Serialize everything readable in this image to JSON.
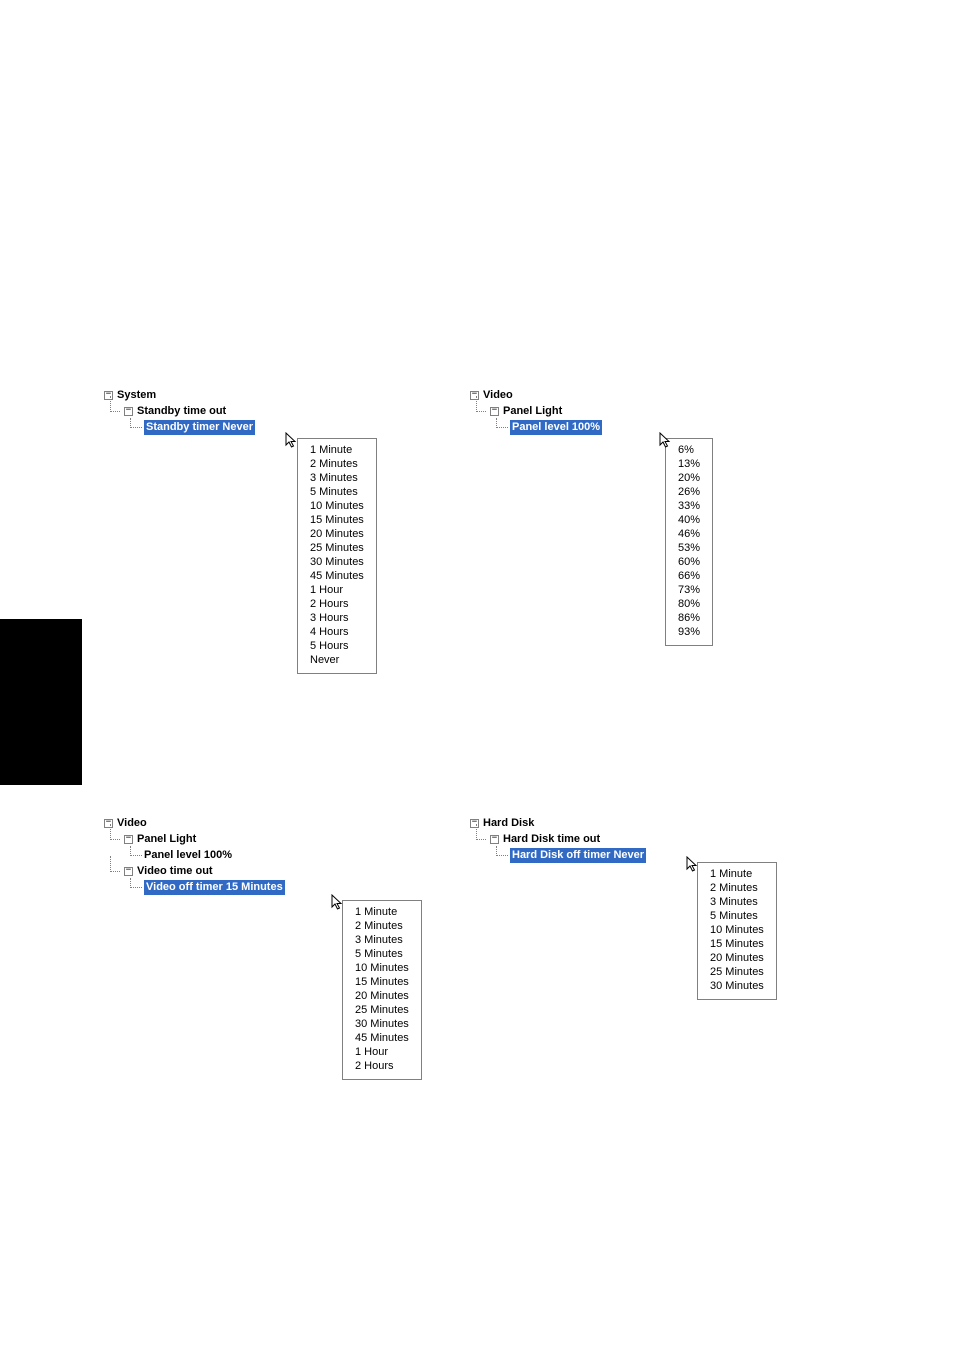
{
  "tree1": {
    "root": "System",
    "level1": "Standby time out",
    "leaf": "Standby timer Never",
    "menu": [
      "1 Minute",
      "2 Minutes",
      "3 Minutes",
      "5 Minutes",
      "10 Minutes",
      "15 Minutes",
      "20 Minutes",
      "25 Minutes",
      "30 Minutes",
      "45 Minutes",
      "1 Hour",
      "2 Hours",
      "3 Hours",
      "4 Hours",
      "5 Hours",
      "Never"
    ]
  },
  "tree2": {
    "root": "Video",
    "level1": "Panel Light",
    "leaf": "Panel level 100%",
    "menu": [
      "6%",
      "13%",
      "20%",
      "26%",
      "33%",
      "40%",
      "46%",
      "53%",
      "60%",
      "66%",
      "73%",
      "80%",
      "86%",
      "93%"
    ]
  },
  "tree3": {
    "root": "Video",
    "level1a": "Panel Light",
    "leaf1a": "Panel level 100%",
    "level1b": "Video time out",
    "leaf1b": "Video off timer 15 Minutes",
    "menu": [
      "1 Minute",
      "2 Minutes",
      "3 Minutes",
      "5 Minutes",
      "10 Minutes",
      "15 Minutes",
      "20 Minutes",
      "25 Minutes",
      "30 Minutes",
      "45 Minutes",
      "1 Hour",
      "2 Hours"
    ]
  },
  "tree4": {
    "root": "Hard Disk",
    "level1": "Hard Disk time out",
    "leaf": "Hard Disk off timer Never",
    "menu": [
      "1 Minute",
      "2 Minutes",
      "3 Minutes",
      "5 Minutes",
      "10 Minutes",
      "15 Minutes",
      "20 Minutes",
      "25 Minutes",
      "30 Minutes"
    ]
  }
}
